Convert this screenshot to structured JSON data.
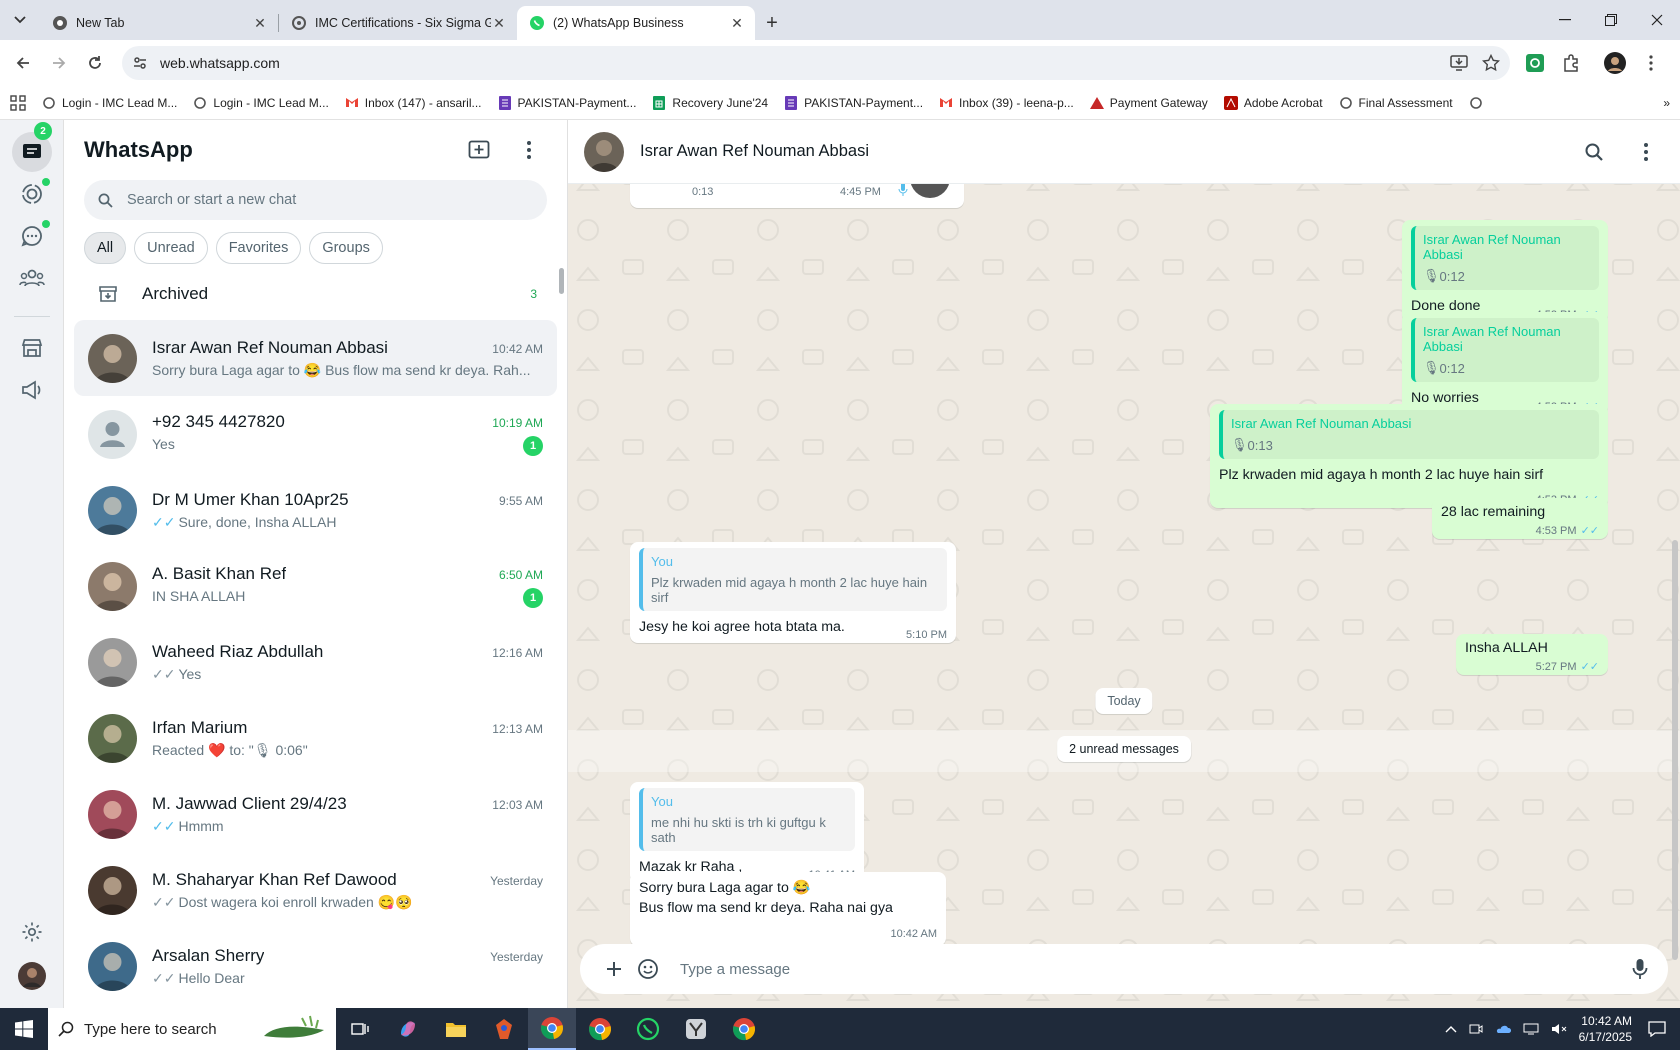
{
  "browser": {
    "tabs": [
      {
        "title": "New Tab",
        "active": false
      },
      {
        "title": "IMC Certifications - Six Sigma G",
        "active": false
      },
      {
        "title": "(2) WhatsApp Business",
        "active": true
      }
    ],
    "url": "web.whatsapp.com",
    "bookmarks": [
      "Login - IMC Lead M...",
      "Login - IMC Lead M...",
      "Inbox (147) - ansaril...",
      "PAKISTAN-Payment...",
      "Recovery June'24",
      "PAKISTAN-Payment...",
      "Inbox (39) - leena-p...",
      "Payment Gateway",
      "Adobe Acrobat",
      "Final Assessment"
    ]
  },
  "rail": {
    "chats_badge": "2"
  },
  "sidebar": {
    "brand": "WhatsApp",
    "search_placeholder": "Search or start a new chat",
    "filters": [
      "All",
      "Unread",
      "Favorites",
      "Groups"
    ],
    "archived_label": "Archived",
    "archived_count": "3",
    "chats": [
      {
        "name": "Israr Awan Ref Nouman Abbasi",
        "time": "10:42 AM",
        "preview": "Sorry bura Laga agar to 😂 Bus flow ma send kr deya. Rah...",
        "tick": "",
        "unread": "",
        "time_green": false,
        "avatar": "#6b6358"
      },
      {
        "name": "+92 345 4427820",
        "time": "10:19 AM",
        "preview": "Yes",
        "tick": "",
        "unread": "1",
        "time_green": true,
        "avatar": "default"
      },
      {
        "name": "Dr M Umer Khan 10Apr25",
        "time": "9:55 AM",
        "preview": "Sure, done, Insha ALLAH",
        "tick": "blue",
        "unread": "",
        "time_green": false,
        "avatar": "#4d7a9a"
      },
      {
        "name": "A. Basit Khan Ref",
        "time": "6:50 AM",
        "preview": "IN SHA ALLAH",
        "tick": "",
        "unread": "1",
        "time_green": true,
        "avatar": "#8c7a6b"
      },
      {
        "name": "Waheed Riaz Abdullah",
        "time": "12:16 AM",
        "preview": "Yes",
        "tick": "grey",
        "unread": "",
        "time_green": false,
        "avatar": "#9a9a9a"
      },
      {
        "name": "Irfan Marium",
        "time": "12:13 AM",
        "preview": "Reacted ❤️ to: \"🎙 0:06\"",
        "tick": "",
        "unread": "",
        "time_green": false,
        "avatar": "#5b6b4a"
      },
      {
        "name": "M. Jawwad Client 29/4/23",
        "time": "12:03 AM",
        "preview": "Hmmm",
        "tick": "blue",
        "unread": "",
        "time_green": false,
        "avatar": "#a04a5a"
      },
      {
        "name": "M. Shaharyar Khan Ref Dawood",
        "time": "Yesterday",
        "preview": "Dost wagera koi enroll krwaden 😋🥺",
        "tick": "grey",
        "unread": "",
        "time_green": false,
        "avatar": "#4a3a30"
      },
      {
        "name": "Arsalan Sherry",
        "time": "Yesterday",
        "preview": "Hello Dear",
        "tick": "grey",
        "unread": "",
        "time_green": false,
        "avatar": "#3e6a8a"
      }
    ]
  },
  "conversation": {
    "contact_name": "Israr Awan Ref Nouman Abbasi",
    "top_voice": {
      "duration": "0:13",
      "time": "4:45 PM"
    },
    "messages": [
      {
        "dir": "out",
        "quote_name": "Israr Awan Ref Nouman Abbasi",
        "quote_text": "0:12",
        "text": "Done done",
        "time": "4:52 PM"
      },
      {
        "dir": "out",
        "quote_name": "Israr Awan Ref Nouman Abbasi",
        "quote_text": "0:12",
        "text": "No worries",
        "time": "4:52 PM"
      },
      {
        "dir": "out",
        "quote_name": "Israr Awan Ref Nouman Abbasi",
        "quote_text": "0:13",
        "text": "Plz krwaden mid agaya h month 2 lac huye hain sirf",
        "time": "4:53 PM"
      },
      {
        "dir": "out",
        "quote_name": "",
        "quote_text": "",
        "text": "28 lac remaining",
        "time": "4:53 PM"
      },
      {
        "dir": "in",
        "quote_name": "You",
        "quote_text": "Plz krwaden mid agaya h month 2 lac huye hain sirf",
        "text": "Jesy he koi agree hota btata ma.",
        "time": "5:10 PM"
      },
      {
        "dir": "out",
        "quote_name": "",
        "quote_text": "",
        "text": "Insha ALLAH",
        "time": "5:27 PM"
      },
      {
        "dir": "in",
        "quote_name": "You",
        "quote_text": "me nhi hu skti is trh ki guftgu k sath",
        "text": "Mazak kr Raha ,",
        "time": "10:41 AM"
      },
      {
        "dir": "in",
        "quote_name": "",
        "quote_text": "",
        "text": "Sorry bura Laga agar to 😂",
        "text2": "Bus flow ma send kr deya. Raha nai gya",
        "time": "10:42 AM"
      }
    ],
    "day_divider": "Today",
    "unread_divider": "2 unread messages",
    "compose_placeholder": "Type a message"
  },
  "taskbar": {
    "search_placeholder": "Type here to search",
    "time": "10:42 AM",
    "date": "6/17/2025"
  }
}
